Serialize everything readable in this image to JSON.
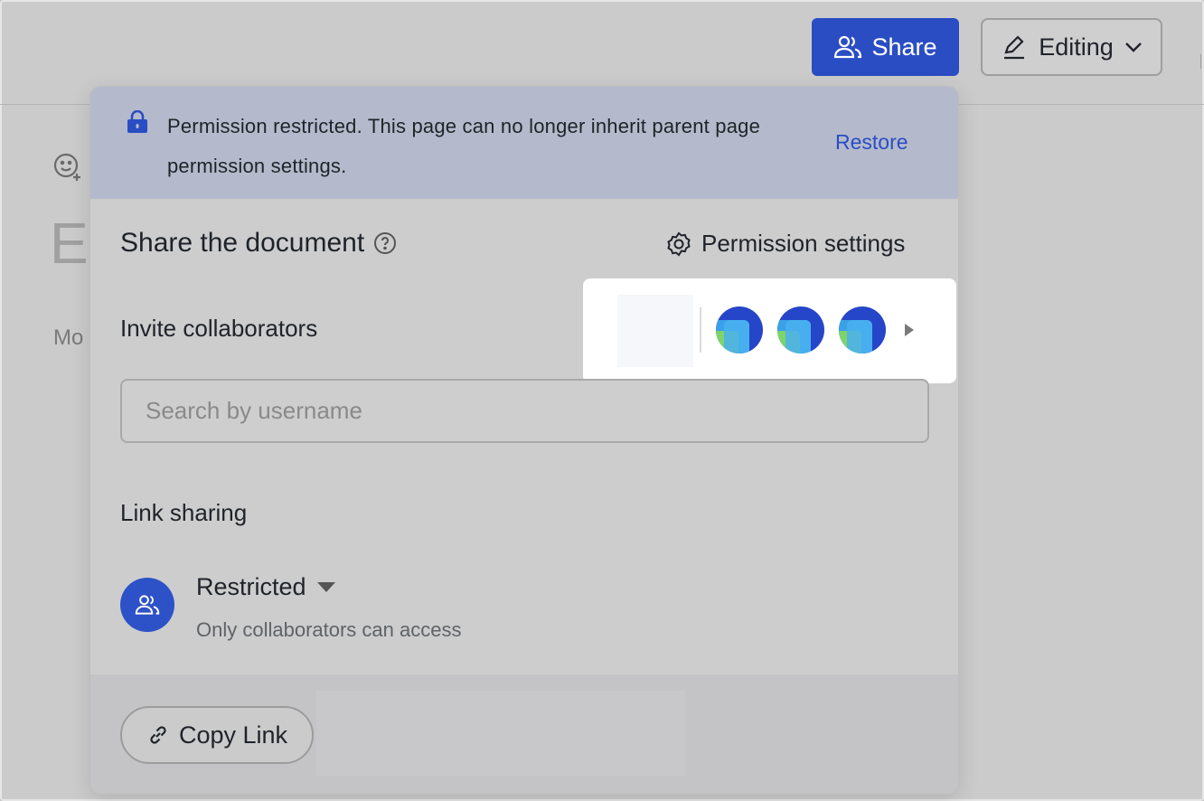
{
  "header": {
    "share_label": "Share",
    "editing_label": "Editing"
  },
  "background": {
    "title_partial": "E",
    "meta_partial": "Mo"
  },
  "banner": {
    "text": "Permission restricted. This page can no longer inherit parent page permission settings.",
    "action": "Restore",
    "bg_color": "#b4bacb"
  },
  "dialog": {
    "title": "Share the document",
    "permission_settings_label": "Permission settings",
    "invite_title": "Invite collaborators",
    "collaborator_apps": [
      "app-icon",
      "app-icon",
      "app-icon"
    ],
    "search_placeholder": "Search by username",
    "link_sharing_title": "Link sharing",
    "link_mode": "Restricted",
    "link_mode_desc": "Only collaborators can access",
    "copy_link_label": "Copy Link"
  },
  "colors": {
    "accent": "#2a4dc4"
  }
}
